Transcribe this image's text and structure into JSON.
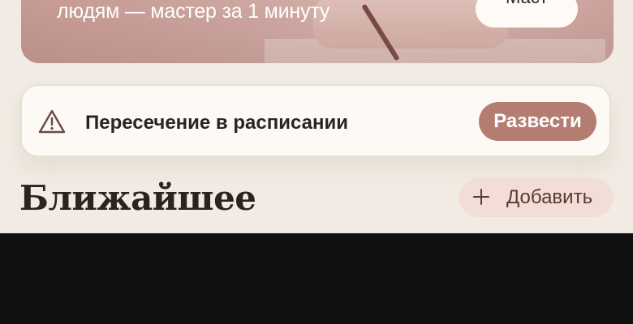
{
  "hero": {
    "text": "людям — мастер за 1 минуту",
    "button_label": "Маст"
  },
  "alert": {
    "icon": "warning-triangle-icon",
    "message": "Пересечение в расписании",
    "action_label": "Развести"
  },
  "section": {
    "title": "Ближайшее",
    "add_icon": "plus-icon",
    "add_label": "Добавить"
  },
  "colors": {
    "background": "#f1ebe3",
    "card": "#fdfaf5",
    "accent": "#b47d72",
    "accent_soft": "#f3ddd7",
    "text": "#2a2523",
    "bottom_bar": "#111111"
  }
}
